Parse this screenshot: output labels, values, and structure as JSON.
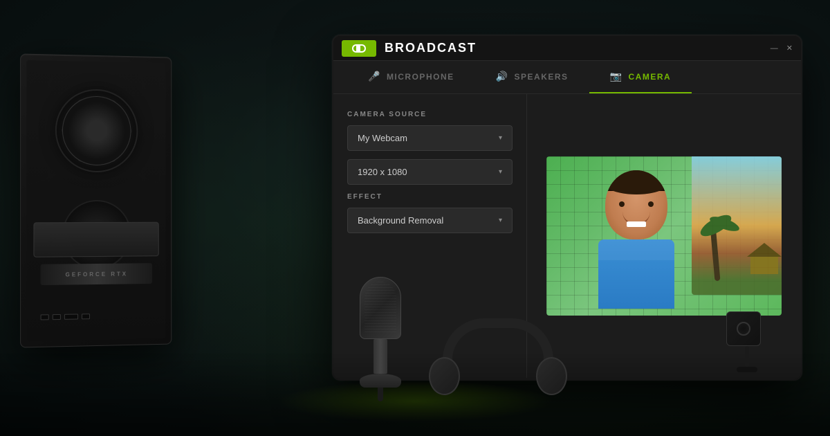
{
  "app": {
    "logo_text": "nvidia.",
    "title": "BROADCAST",
    "window_minimize": "—",
    "window_close": "✕"
  },
  "nav": {
    "tabs": [
      {
        "id": "microphone",
        "label": "MICROPHONE",
        "icon": "🎤",
        "active": false
      },
      {
        "id": "speakers",
        "label": "SPEAKERS",
        "icon": "🔊",
        "active": false
      },
      {
        "id": "camera",
        "label": "CAMERA",
        "icon": "📷",
        "active": true
      }
    ]
  },
  "left_panel": {
    "camera_source_label": "CAMERA SOURCE",
    "camera_source_value": "My Webcam",
    "resolution_value": "1920 x 1080",
    "effect_label": "EFFECT",
    "effect_value": "Background Removal",
    "dropdown_arrow": "▾"
  },
  "preview": {
    "alt": "Camera preview with background removal effect"
  },
  "colors": {
    "accent": "#76b900",
    "bg_dark": "#1c1c1c",
    "bg_darker": "#141414"
  }
}
